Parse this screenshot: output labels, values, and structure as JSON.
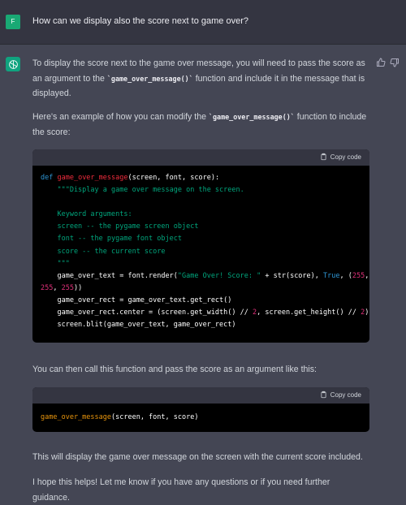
{
  "user_message": {
    "avatar_letter": "F",
    "text": "How can we display also the score next to game over?"
  },
  "assistant": {
    "p1": {
      "a": "To display the score next to the game over message, you will need to pass the score as an argument to the ",
      "code": "`game_over_message()`",
      "b": " function and include it in the message that is displayed."
    },
    "p2": {
      "a": "Here's an example of how you can modify the ",
      "code": "`game_over_message()`",
      "b": " function to include the score:"
    },
    "p3": "You can then call this function and pass the score as an argument like this:",
    "p4": "This will display the game over message on the screen with the current score included.",
    "p5": "I hope this helps! Let me know if you have any questions or if you need further guidance."
  },
  "code_block_1": {
    "copy_label": "Copy code",
    "lines": {
      "l1_kw": "def",
      "l1_fn": "game_over_message",
      "l1_rest": "(screen, font, score):",
      "l2": "    \"\"\"Display a game over message on the screen.",
      "l4": "    Keyword arguments:",
      "l5": "    screen -- the pygame screen object",
      "l6": "    font -- the pygame font object",
      "l7": "    score -- the current score",
      "l8": "    \"\"\"",
      "l9_a": "    game_over_text = font.render(",
      "l9_str": "\"Game Over! Score: \"",
      "l9_b": " + str(score), ",
      "l9_true": "True",
      "l9_c": ", (",
      "l9_n1": "255",
      "l9_d": ",",
      "l10_n2": "255",
      "l10_e": ", ",
      "l10_n3": "255",
      "l10_f": "))",
      "l11": "    game_over_rect = game_over_text.get_rect()",
      "l12_a": "    game_over_rect.center = (screen.get_width() // ",
      "l12_n1": "2",
      "l12_b": ", screen.get_height() // ",
      "l12_n2": "2",
      "l12_c": ")",
      "l13": "    screen.blit(game_over_text, game_over_rect)"
    }
  },
  "code_block_2": {
    "copy_label": "Copy code",
    "call": "game_over_message",
    "rest": "(screen, font, score)"
  }
}
